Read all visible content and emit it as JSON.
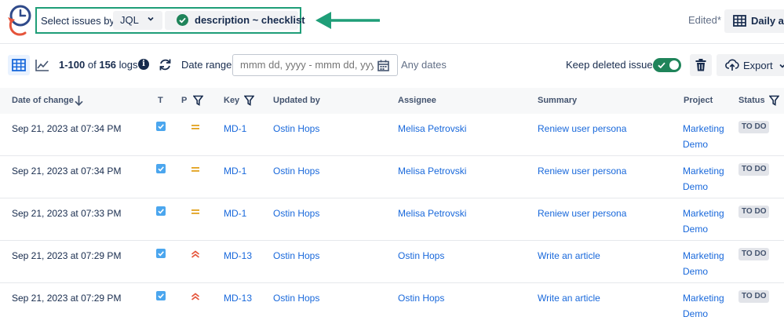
{
  "header": {
    "select_label": "Select issues by:",
    "mode": "JQL",
    "query": "description ~ checklist",
    "edited": "Edited*",
    "view_name": "Daily ac"
  },
  "toolbar": {
    "range": "1-100",
    "of": "of",
    "total": "156",
    "unit": "logs",
    "date_range_label": "Date range:",
    "date_placeholder": "mmm dd, yyyy - mmm dd, yyyy",
    "any_dates": "Any dates",
    "keep_deleted_label": "Keep deleted issues",
    "keep_deleted_on": true,
    "export_label": "Export"
  },
  "columns": {
    "date": "Date of change",
    "t": "T",
    "p": "P",
    "key": "Key",
    "updated_by": "Updated by",
    "assignee": "Assignee",
    "summary": "Summary",
    "project": "Project",
    "status": "Status"
  },
  "rows": [
    {
      "date": "Sep 21, 2023 at 07:34 PM",
      "priority": "medium",
      "key": "MD-1",
      "updated_by": "Ostin Hops",
      "assignee": "Melisa Petrovski",
      "summary": "Reniew user persona",
      "project": "Marketing Demo",
      "status": "TO DO"
    },
    {
      "date": "Sep 21, 2023 at 07:34 PM",
      "priority": "medium",
      "key": "MD-1",
      "updated_by": "Ostin Hops",
      "assignee": "Melisa Petrovski",
      "summary": "Reniew user persona",
      "project": "Marketing Demo",
      "status": "TO DO"
    },
    {
      "date": "Sep 21, 2023 at 07:33 PM",
      "priority": "medium",
      "key": "MD-1",
      "updated_by": "Ostin Hops",
      "assignee": "Melisa Petrovski",
      "summary": "Reniew user persona",
      "project": "Marketing Demo",
      "status": "TO DO"
    },
    {
      "date": "Sep 21, 2023 at 07:29 PM",
      "priority": "high",
      "key": "MD-13",
      "updated_by": "Ostin Hops",
      "assignee": "Ostin Hops",
      "summary": "Write an article",
      "project": "Marketing Demo",
      "status": "TO DO"
    },
    {
      "date": "Sep 21, 2023 at 07:29 PM",
      "priority": "high",
      "key": "MD-13",
      "updated_by": "Ostin Hops",
      "assignee": "Ostin Hops",
      "summary": "Write an article",
      "project": "Marketing Demo",
      "status": "TO DO"
    }
  ],
  "colors": {
    "accent": "#1868db",
    "highlight_border": "#1f9e78",
    "toggle_on": "#1f845a",
    "priority_medium": "#e2a21f",
    "priority_high": "#e5543a",
    "task_icon": "#4ba6ee"
  },
  "icons": {
    "logo": "clock-history-icon",
    "grid_view": "grid-icon",
    "chart_view": "chart-icon",
    "info": "info-icon",
    "refresh": "refresh-icon",
    "calendar": "calendar-icon",
    "trash": "trash-icon",
    "export": "cloud-upload-icon",
    "sort": "arrow-down-icon",
    "filter": "filter-icon"
  }
}
